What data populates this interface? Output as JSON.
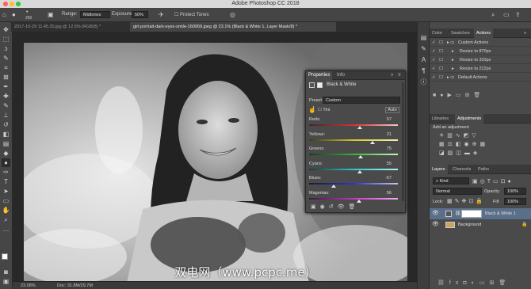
{
  "app": {
    "title": "Adobe Photoshop CC 2018"
  },
  "options": {
    "brush_size": "250",
    "range_label": "Range:",
    "range_value": "Midtones",
    "exposure_label": "Exposure:",
    "exposure_value": "50%",
    "protect_tones": "Protect Tones"
  },
  "tabs": [
    {
      "label": "2017-10-29 11.45.30.jpg @ 12.5% (RGB/8) *"
    },
    {
      "label": "girl-portrait-dark-eyes-smile-160959.jpeg @ 23.1% (Black & White 1, Layer Mask/8) *"
    }
  ],
  "status": {
    "zoom": "23.08%",
    "doc": "Doc: 31.8M/29.7M"
  },
  "properties": {
    "tabs": [
      "Properties",
      "Info"
    ],
    "adjustment": "Black & White",
    "preset_label": "Preset:",
    "preset_value": "Custom",
    "tint_label": "Tint",
    "auto_label": "Auto",
    "sliders": [
      {
        "label": "Reds:",
        "value": "57",
        "pct": 0.57
      },
      {
        "label": "Yellows:",
        "value": "21",
        "pct": 0.71
      },
      {
        "label": "Greens:",
        "value": "75",
        "pct": 0.58
      },
      {
        "label": "Cyans:",
        "value": "55",
        "pct": 0.57
      },
      {
        "label": "Blues:",
        "value": "-57",
        "pct": 0.28
      },
      {
        "label": "Magentas:",
        "value": "56",
        "pct": 0.56
      }
    ]
  },
  "panels": {
    "top_tabs": [
      "Color",
      "Swatches",
      "Actions"
    ],
    "actions": [
      "Custom Actions",
      "Resize to 870px",
      "Resize to 333px",
      "Resize to 222px",
      "Default Actions"
    ],
    "mid_tabs": [
      "Libraries",
      "Adjustments"
    ],
    "add_adjustment": "Add an adjustment",
    "layer_tabs": [
      "Layers",
      "Channels",
      "Paths"
    ],
    "kind": "Kind",
    "blend_mode": "Normal",
    "opacity_label": "Opacity:",
    "opacity_value": "100%",
    "lock_label": "Lock:",
    "fill_label": "Fill:",
    "fill_value": "100%",
    "layers": [
      "Black & White 1",
      "Background"
    ]
  },
  "watermark": "双电网（www.pcpc.me）",
  "colors": {
    "ui_dark": "#3c3c3c",
    "panel": "#4a4a4a",
    "highlight": "#4b6a91"
  }
}
